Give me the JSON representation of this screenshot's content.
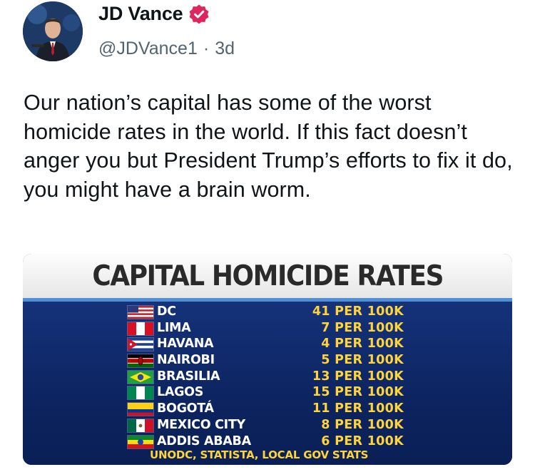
{
  "author": {
    "name": "JD Vance",
    "handle": "@JDVance1",
    "separator": "·",
    "time": "3d",
    "avatar_icon": "profile-photo",
    "verified_icon": "verified-badge-icon",
    "verified_color": "#e0245e"
  },
  "tweet": {
    "text": "Our nation’s capital has some of the worst homicide rates in the world. If this fact doesn’t anger you but President Trump’s efforts to fix it do, you might have a brain worm."
  },
  "graphic": {
    "title": "CAPITAL HOMICIDE RATES",
    "rows": [
      {
        "city": "DC",
        "rate": "41 PER 100K",
        "flag": "us-flag-icon"
      },
      {
        "city": "LIMA",
        "rate": "7 PER 100K",
        "flag": "peru-flag-icon"
      },
      {
        "city": "HAVANA",
        "rate": "4 PER 100K",
        "flag": "cuba-flag-icon"
      },
      {
        "city": "NAIROBI",
        "rate": "5 PER 100K",
        "flag": "kenya-flag-icon"
      },
      {
        "city": "BRASILIA",
        "rate": "13 PER 100K",
        "flag": "brazil-flag-icon"
      },
      {
        "city": "LAGOS",
        "rate": "15 PER 100K",
        "flag": "nigeria-flag-icon"
      },
      {
        "city": "BOGOTÁ",
        "rate": "11 PER 100K",
        "flag": "colombia-flag-icon"
      },
      {
        "city": "MEXICO CITY",
        "rate": "8 PER 100K",
        "flag": "mexico-flag-icon"
      },
      {
        "city": "ADDIS ABABA",
        "rate": "6 PER 100K",
        "flag": "ethiopia-flag-icon"
      }
    ],
    "source": "UNODC, STATISTA, LOCAL GOV STATS",
    "colors": {
      "title_bar": "#eeeeee",
      "body": "#0c2460",
      "city": "#ffffff",
      "rate": "#ffd43b"
    }
  }
}
